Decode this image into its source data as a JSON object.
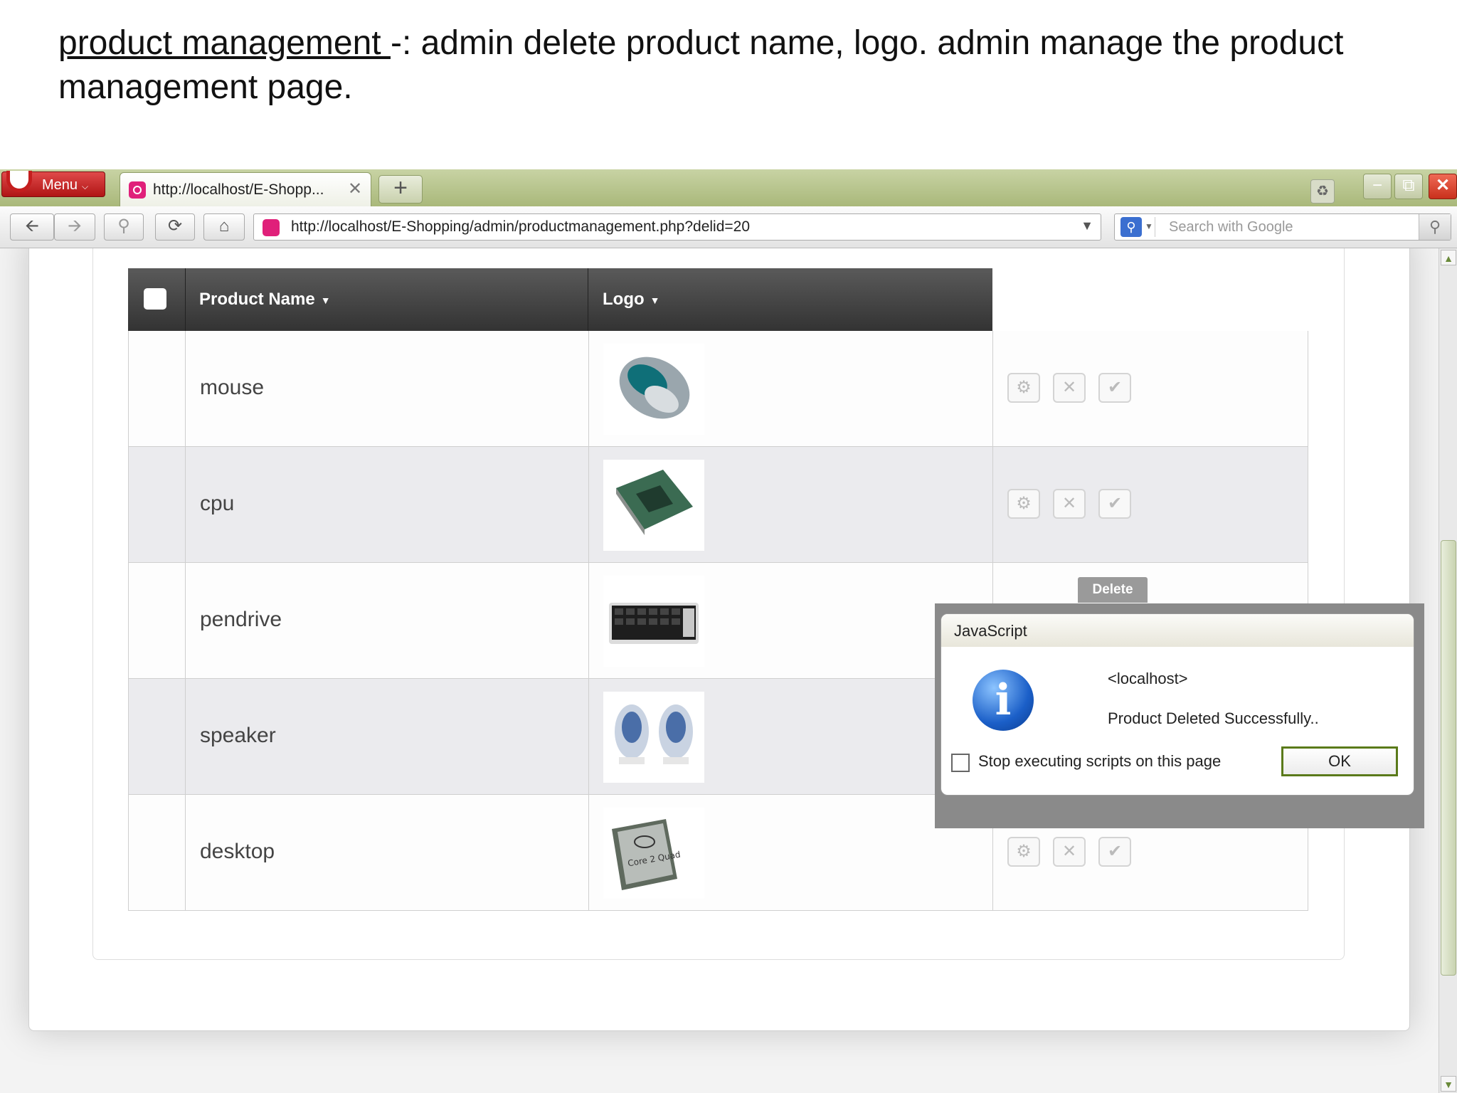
{
  "slide": {
    "heading_underlined": "product management ",
    "heading_rest": "-: admin delete product name, logo.  admin manage the product management page."
  },
  "browser": {
    "menu_label": "Menu",
    "tab_title": "http://localhost/E-Shopp...",
    "address_url": "http://localhost/E-Shopping/admin/productmanagement.php?delid=20",
    "search_placeholder": "Search with Google"
  },
  "grid": {
    "columns": [
      "Product Name",
      "Logo"
    ],
    "rows": [
      {
        "name": "mouse",
        "logo": "mouse-image"
      },
      {
        "name": "cpu",
        "logo": "cpu-chip-image"
      },
      {
        "name": "pendrive",
        "logo": "keyboard-image"
      },
      {
        "name": "speaker",
        "logo": "speakers-image"
      },
      {
        "name": "desktop",
        "logo": "intel-core2quad-image"
      }
    ],
    "actions": [
      "gear-icon",
      "delete-icon",
      "check-icon"
    ]
  },
  "tooltip": "Delete",
  "dialog": {
    "title": "JavaScript",
    "host": "<localhost>",
    "message": "Product Deleted Successfully..",
    "checkbox_label": "Stop executing scripts on this page",
    "ok_label": "OK"
  }
}
